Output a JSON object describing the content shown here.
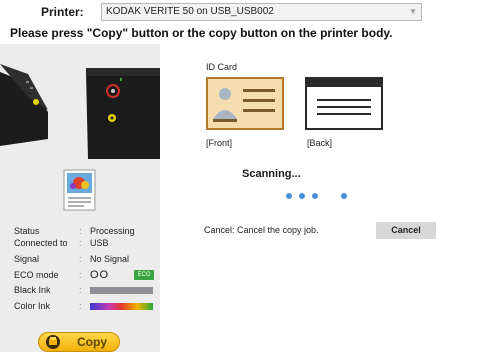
{
  "printer": {
    "label": "Printer:",
    "selected": "KODAK VERITE 50 on USB_USB002"
  },
  "instruction": "Please press \"Copy\" button or the copy button on the printer body.",
  "status": {
    "rows": [
      {
        "key": "Status",
        "value": "Processing"
      },
      {
        "key": "Connected to",
        "value": "USB"
      },
      {
        "key": "Signal",
        "value": "No Signal"
      }
    ],
    "eco_mode_label": "ECO mode",
    "eco_mode_value": "OO",
    "eco_badge": "ECO",
    "black_ink_label": "Black Ink",
    "color_ink_label": "Color Ink",
    "separator": ":"
  },
  "copy_button": {
    "label": "Copy"
  },
  "id_card": {
    "label": "ID Card",
    "front_caption": "[Front]",
    "back_caption": "[Back]"
  },
  "scanning": {
    "label": "Scanning..."
  },
  "cancel": {
    "description": "Cancel: Cancel the copy job.",
    "button_label": "Cancel"
  },
  "colors": {
    "accent_blue": "#4a90d9",
    "eco_green": "#3aa540",
    "copy_yellow": "#f2b10a",
    "card_front_fill": "#f6ddb0"
  }
}
